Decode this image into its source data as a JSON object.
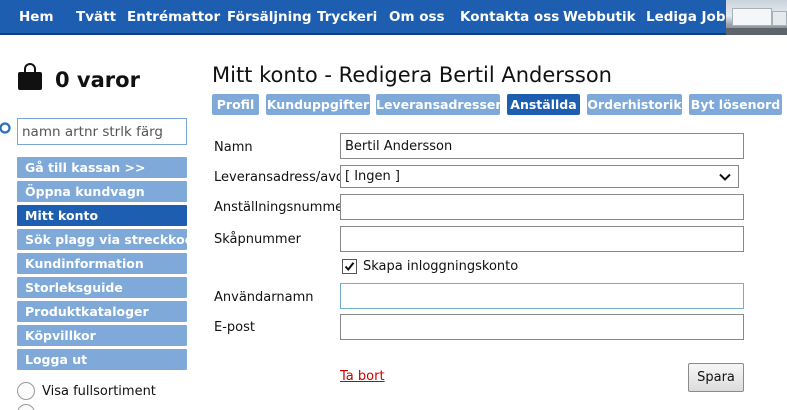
{
  "topnav": {
    "items": [
      "Hem",
      "Tvätt",
      "Entrémattor",
      "Försäljning",
      "Tryckeri",
      "Om oss",
      "Kontakta oss",
      "Webbutik",
      "Lediga Jobb"
    ]
  },
  "cart": {
    "label": "0 varor"
  },
  "search": {
    "placeholder": "namn artnr strlk färg"
  },
  "sidebar": {
    "items": [
      {
        "label": "Gå till kassan >>"
      },
      {
        "label": "Öppna kundvagn"
      },
      {
        "label": "Mitt konto",
        "active": true
      },
      {
        "label": "Sök plagg via streckkod"
      },
      {
        "label": "Kundinformation"
      },
      {
        "label": "Storleksguide"
      },
      {
        "label": "Produktkataloger"
      },
      {
        "label": "Köpvillkor"
      },
      {
        "label": "Logga ut"
      }
    ],
    "radio": {
      "label": "Visa fullsortiment"
    }
  },
  "main": {
    "title": "Mitt konto - Redigera Bertil Andersson",
    "tabs": [
      {
        "label": "Profil"
      },
      {
        "label": "Kunduppgifter"
      },
      {
        "label": "Leveransadresser"
      },
      {
        "label": "Anställda",
        "active": true
      },
      {
        "label": "Orderhistorik"
      },
      {
        "label": "Byt lösenord"
      }
    ]
  },
  "form": {
    "name_label": "Namn",
    "name_value": "Bertil Andersson",
    "address_label": "Leveransadress/avd",
    "address_value": "[ Ingen ]",
    "employee_no_label": "Anställningsnummer",
    "employee_no_value": "",
    "locker_label": "Skåpnummer",
    "locker_value": "",
    "create_login_label": "Skapa inloggningskonto",
    "create_login_checked": true,
    "username_label": "Användarnamn",
    "username_value": "",
    "email_label": "E-post",
    "email_value": "",
    "delete_label": "Ta bort",
    "save_label": "Spara"
  },
  "colors": {
    "nav": "#1d5eb0",
    "button": "#7fa9d8",
    "active": "#1d5eb0",
    "link": "#cc0000"
  }
}
